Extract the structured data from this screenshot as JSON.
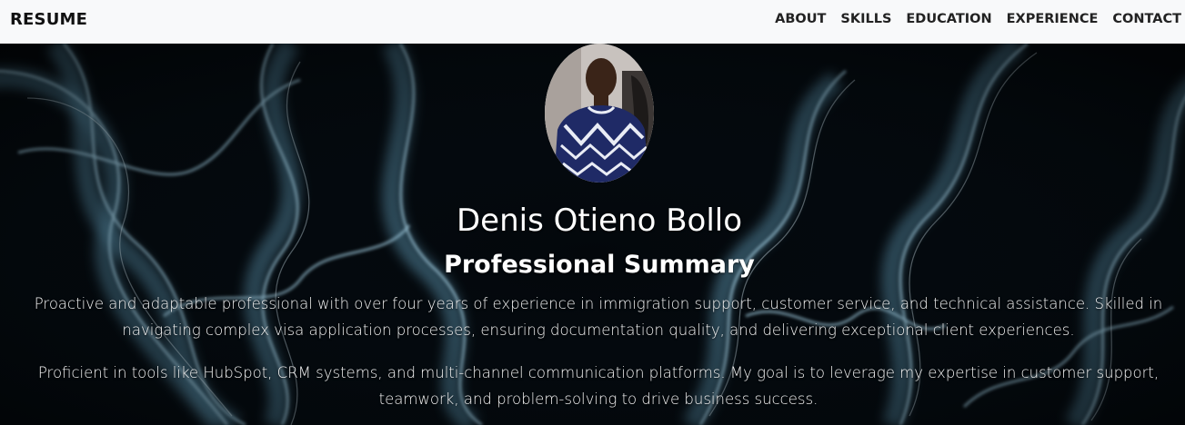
{
  "navbar": {
    "brand": "RESUME",
    "links": [
      "ABOUT",
      "SKILLS",
      "EDUCATION",
      "EXPERIENCE",
      "CONTACT"
    ]
  },
  "hero": {
    "name": "Denis Otieno Bollo",
    "heading": "Professional Summary",
    "paragraphs": [
      "Proactive and adaptable professional with over four years of experience in immigration support, customer service, and technical assistance. Skilled in navigating complex visa application processes, ensuring documentation quality, and delivering exceptional client experiences.",
      "Proficient in tools like HubSpot, CRM systems, and multi-channel communication platforms. My goal is to leverage my expertise in customer support, teamwork, and problem-solving to drive business success."
    ]
  },
  "colors": {
    "navbar_bg": "#f8f9fa",
    "hero_bg": "#020406",
    "smoke": "#8fc4dc",
    "text": "#ffffff"
  }
}
